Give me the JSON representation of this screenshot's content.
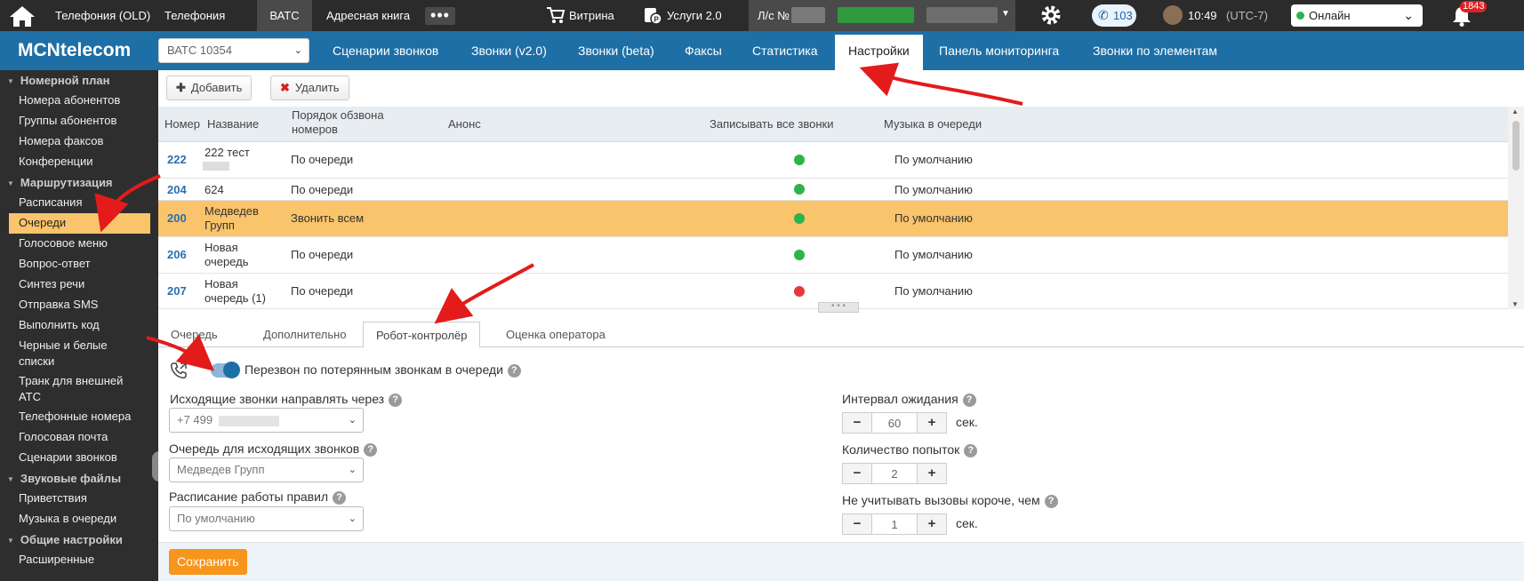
{
  "topbar": {
    "nav": [
      "Телефония (OLD)",
      "Телефония",
      "ВАТС",
      "Адресная книга"
    ],
    "more": "•••",
    "shop": "Витрина",
    "services": "Услуги 2.0",
    "account_prefix": "Л/с №",
    "calls_count": "103",
    "time": "10:49",
    "timezone": "(UTC-7)",
    "status": "Онлайн",
    "notifications": "1843"
  },
  "secbar": {
    "logo": "MCNtelecom",
    "vatc_select": "ВАТС 10354",
    "nav": [
      "Сценарии звонков",
      "Звонки (v2.0)",
      "Звонки (beta)",
      "Факсы",
      "Статистика",
      "Настройки",
      "Панель мониторинга",
      "Звонки по элементам"
    ],
    "active_nav": "Настройки"
  },
  "sidebar": {
    "sections": [
      {
        "title": "Номерной план",
        "items": [
          "Номера абонентов",
          "Группы абонентов",
          "Номера факсов",
          "Конференции"
        ]
      },
      {
        "title": "Маршрутизация",
        "items": [
          "Расписания",
          "Очереди",
          "Голосовое меню",
          "Вопрос-ответ",
          "Синтез речи",
          "Отправка SMS",
          "Выполнить код",
          "Черные и белые списки",
          "Транк для внешней АТС",
          "Телефонные номера",
          "Голосовая почта",
          "Сценарии звонков"
        ]
      },
      {
        "title": "Звуковые файлы",
        "items": [
          "Приветствия",
          "Музыка в очереди"
        ]
      },
      {
        "title": "Общие настройки",
        "items": [
          "Расширенные"
        ]
      }
    ],
    "active_item": "Очереди"
  },
  "toolbar": {
    "add": "Добавить",
    "delete": "Удалить"
  },
  "grid": {
    "columns": [
      "Номер",
      "Название",
      "Порядок обзвона номеров",
      "Анонс",
      "Записывать все звонки",
      "Музыка в очереди"
    ],
    "rows": [
      {
        "num": "222",
        "name": "222 тест",
        "order": "По очереди",
        "announce": "",
        "record": "green",
        "music": "По умолчанию"
      },
      {
        "num": "204",
        "name": "624",
        "order": "По очереди",
        "announce": "",
        "record": "green",
        "music": "По умолчанию"
      },
      {
        "num": "200",
        "name": "Медведев Групп",
        "order": "Звонить всем",
        "announce": "",
        "record": "green",
        "music": "По умолчанию"
      },
      {
        "num": "206",
        "name": "Новая очередь",
        "order": "По очереди",
        "announce": "",
        "record": "green",
        "music": "По умолчанию"
      },
      {
        "num": "207",
        "name": "Новая очередь (1)",
        "order": "По очереди",
        "announce": "",
        "record": "red",
        "music": "По умолчанию"
      }
    ],
    "selected_num": "200"
  },
  "tabs": [
    "Очередь",
    "Дополнительно",
    "Робот-контролёр",
    "Оценка оператора"
  ],
  "active_tab": "Робот-контролёр",
  "form": {
    "callback_toggle_label": "Перезвон по потерянным звонкам в очереди",
    "callback_enabled": true,
    "outgoing_label": "Исходящие звонки направлять через",
    "outgoing_value": "+7 499",
    "queue_label": "Очередь для исходящих звонков",
    "queue_value": "Медведев Групп",
    "schedule_label": "Расписание работы правил",
    "schedule_value": "По умолчанию",
    "interval_label": "Интервал ожидания",
    "interval_value": "60",
    "interval_unit": "сек.",
    "attempts_label": "Количество попыток",
    "attempts_value": "2",
    "ignore_label": "Не учитывать вызовы короче, чем",
    "ignore_value": "1",
    "ignore_unit": "сек.",
    "help": "?"
  },
  "footer": {
    "save": "Сохранить"
  },
  "colors": {
    "brand": "#1e6fa6",
    "topbar": "#2b2b2b",
    "selected_row": "#f9c46b",
    "save": "#f7951d",
    "record_on": "#2db34a",
    "record_off": "#e53935",
    "annotation_arrow": "#e31b1b"
  }
}
